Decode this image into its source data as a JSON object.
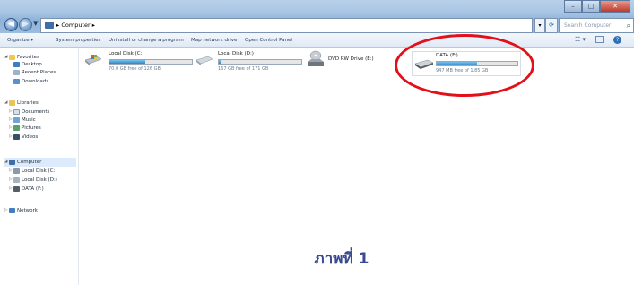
{
  "address": {
    "crumbs": [
      "Computer"
    ],
    "search_placeholder": "Search Computer"
  },
  "toolbar": {
    "organize": "Organize ▾",
    "system_properties": "System properties",
    "uninstall": "Uninstall or change a program",
    "map_drive": "Map network drive",
    "control_panel": "Open Control Panel"
  },
  "nav": {
    "favorites": "Favorites",
    "desktop": "Desktop",
    "recent_places": "Recent Places",
    "downloads": "Downloads",
    "libraries": "Libraries",
    "documents": "Documents",
    "music": "Music",
    "pictures": "Pictures",
    "videos": "Videos",
    "computer": "Computer",
    "local_c": "Local Disk (C:)",
    "local_d": "Local Disk (D:)",
    "data_f": "DATA (F:)",
    "network": "Network"
  },
  "drives": {
    "c": {
      "name": "Local Disk (C:)",
      "free": "70.0 GB free of 126 GB",
      "used_fraction": 0.44
    },
    "d": {
      "name": "Local Disk (D:)",
      "free": "167 GB free of 171 GB",
      "used_fraction": 0.03
    },
    "e": {
      "name": "DVD RW Drive (E:)"
    },
    "f": {
      "name": "DATA (F:)",
      "free": "947 MB free of 1.85 GB",
      "used_fraction": 0.5
    }
  },
  "caption": "ภาพที่ 1",
  "colors": {
    "highlight_oval": "#e3101a",
    "caption": "#3a4b93",
    "bar_fill": "#2a86c8"
  }
}
